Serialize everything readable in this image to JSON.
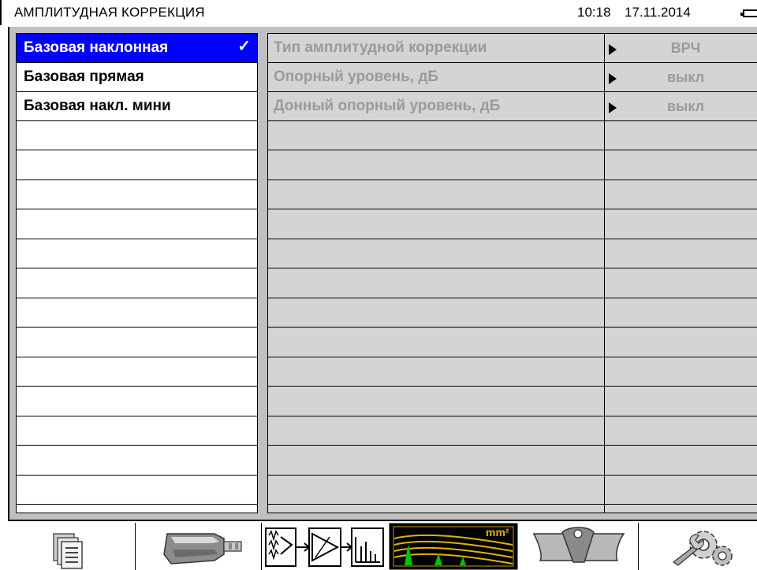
{
  "header": {
    "title": "АМПЛИТУДНАЯ КОРРЕКЦИЯ",
    "time": "10:18",
    "date": "17.11.2014",
    "battery_icon": "battery-icon"
  },
  "left_list": {
    "items": [
      {
        "label": "Базовая наклонная",
        "selected": true
      },
      {
        "label": "Базовая прямая",
        "selected": false
      },
      {
        "label": "Базовая накл. мини",
        "selected": false
      }
    ],
    "empty_rows": 13,
    "check_mark": "✓"
  },
  "parameters": {
    "rows": [
      {
        "name": "Тип амплитудной коррекции",
        "value": "ВРЧ"
      },
      {
        "name": "Опорный уровень, дБ",
        "value": "выкл"
      },
      {
        "name": "Донный опорный уровень, дБ",
        "value": "выкл"
      }
    ],
    "empty_rows": 13
  },
  "toolbar": {
    "buttons": [
      {
        "icon": "documents-icon"
      },
      {
        "icon": "probe-icon"
      },
      {
        "icon": "signal-chain-icon"
      },
      {
        "icon": "dac-curve-icon",
        "label": "mm²"
      },
      {
        "icon": "weld-joint-icon"
      },
      {
        "icon": "settings-gears-icon"
      }
    ]
  },
  "colors": {
    "selection": "#0000ff",
    "panel_bg": "#c0c0c0",
    "table_bg": "#d4d4d4",
    "disabled_text": "#9a9a9a"
  }
}
